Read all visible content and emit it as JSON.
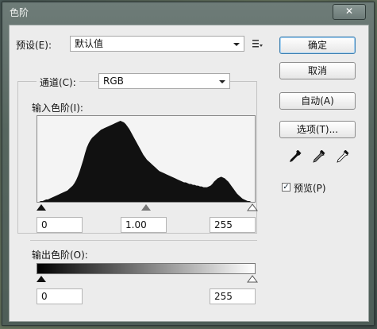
{
  "window": {
    "title": "色阶",
    "close_symbol": "✕"
  },
  "preset": {
    "label": "预设(E):",
    "value": "默认值",
    "menu_icon": "preset-options-icon"
  },
  "channel": {
    "label": "通道(C):",
    "value": "RGB"
  },
  "input_levels": {
    "label": "输入色阶(I):",
    "black": "0",
    "gamma": "1.00",
    "white": "255"
  },
  "output_levels": {
    "label": "输出色阶(O):",
    "black": "0",
    "white": "255"
  },
  "buttons": {
    "ok": "确定",
    "cancel": "取消",
    "auto": "自动(A)",
    "options": "选项(T)..."
  },
  "preview": {
    "label": "预览(P)",
    "checked": true
  },
  "eyedroppers": [
    "black-point-eyedropper-icon",
    "gray-point-eyedropper-icon",
    "white-point-eyedropper-icon"
  ],
  "histogram": {
    "levels": [
      0,
      0,
      1,
      1,
      2,
      3,
      3,
      4,
      5,
      6,
      7,
      8,
      9,
      10,
      11,
      12,
      13,
      14,
      16,
      18,
      20,
      23,
      27,
      32,
      38,
      45,
      52,
      60,
      67,
      72,
      76,
      79,
      81,
      83,
      85,
      87,
      89,
      90,
      91,
      92,
      93,
      94,
      95,
      96,
      97,
      98,
      99,
      100,
      99,
      98,
      96,
      93,
      90,
      86,
      82,
      78,
      74,
      70,
      66,
      62,
      58,
      55,
      52,
      50,
      48,
      46,
      44,
      42,
      40,
      38,
      37,
      36,
      35,
      34,
      33,
      32,
      31,
      30,
      29,
      28,
      27,
      26,
      25,
      24,
      24,
      23,
      22,
      22,
      21,
      21,
      20,
      20,
      19,
      19,
      18,
      18,
      18,
      19,
      20,
      22,
      25,
      27,
      29,
      30,
      31,
      30,
      29,
      27,
      25,
      22,
      19,
      16,
      13,
      10,
      8,
      6,
      4,
      3,
      2,
      1,
      1,
      0,
      0,
      0
    ]
  }
}
